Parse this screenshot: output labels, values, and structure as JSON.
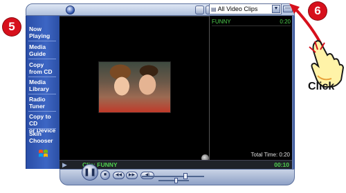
{
  "callouts": {
    "step_left": "5",
    "step_right": "6",
    "click_label": "Click"
  },
  "player": {
    "playlist_dropdown": "All Video Clips",
    "nav": [
      {
        "label_line1": "Now",
        "label_line2": "Playing",
        "active": true
      },
      {
        "label_line1": "Media",
        "label_line2": "Guide"
      },
      {
        "label_line1": "Copy",
        "label_line2": "from CD"
      },
      {
        "label_line1": "Media",
        "label_line2": "Library"
      },
      {
        "label_line1": "Radio",
        "label_line2": "Tuner"
      },
      {
        "label_line1": "Copy to CD",
        "label_line2": "or Device"
      },
      {
        "label_line1": "Skin",
        "label_line2": "Chooser"
      }
    ],
    "playlist": {
      "items": [
        {
          "title": "FUNNY",
          "duration": "0:20"
        }
      ],
      "total_time": "Total Time: 0:20"
    },
    "clip_bar": {
      "clip_label": "Clip: FUNNY",
      "elapsed": "00:10"
    },
    "transport": {
      "seek_position": 0.72,
      "volume_level": 0.6
    }
  },
  "colors": {
    "accent_red": "#d7101c",
    "status_green": "#4fd04f",
    "nav_blue": "#3d66c4"
  },
  "icons": [
    "wmp-logo-icon",
    "windows-flag-icon",
    "visualization-icon",
    "play-icon",
    "pause-icon",
    "stop-icon",
    "previous-icon",
    "next-icon",
    "mute-icon",
    "hand-cursor-icon"
  ]
}
